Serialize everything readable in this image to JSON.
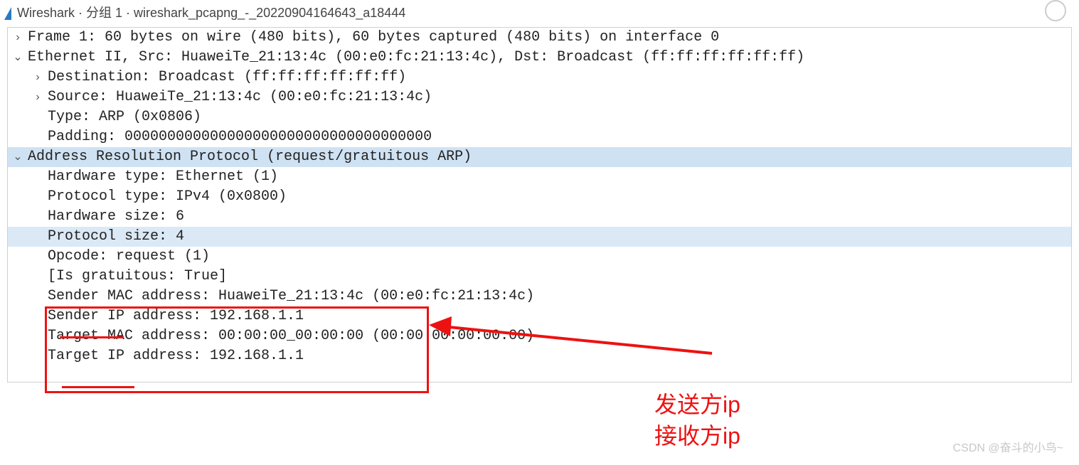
{
  "window": {
    "title": "Wireshark · 分组 1 · wireshark_pcapng_-_20220904164643_a18444"
  },
  "tree": {
    "frame": "Frame 1: 60 bytes on wire (480 bits), 60 bytes captured (480 bits) on interface 0",
    "eth": "Ethernet II, Src: HuaweiTe_21:13:4c (00:e0:fc:21:13:4c), Dst: Broadcast (ff:ff:ff:ff:ff:ff)",
    "eth_dst": "Destination: Broadcast (ff:ff:ff:ff:ff:ff)",
    "eth_src": "Source: HuaweiTe_21:13:4c (00:e0:fc:21:13:4c)",
    "eth_type": "Type: ARP (0x0806)",
    "eth_pad": "Padding: 000000000000000000000000000000000000",
    "arp": "Address Resolution Protocol (request/gratuitous ARP)",
    "arp_hw": "Hardware type: Ethernet (1)",
    "arp_proto": "Protocol type: IPv4 (0x0800)",
    "arp_hwsize": "Hardware size: 6",
    "arp_psize": "Protocol size: 4",
    "arp_opcode": "Opcode: request (1)",
    "arp_grat": "[Is gratuitous: True]",
    "arp_smac": "Sender MAC address: HuaweiTe_21:13:4c (00:e0:fc:21:13:4c)",
    "arp_sip": "Sender IP address: 192.168.1.1",
    "arp_tmac": "Target MAC address: 00:00:00_00:00:00 (00:00:00:00:00:00)",
    "arp_tip": "Target IP address: 192.168.1.1"
  },
  "glyphs": {
    "collapsed": "›",
    "expanded": "⌄"
  },
  "annotations": {
    "sender": "发送方ip",
    "receiver": "接收方ip"
  },
  "watermark": "CSDN @奋斗的小鸟~"
}
